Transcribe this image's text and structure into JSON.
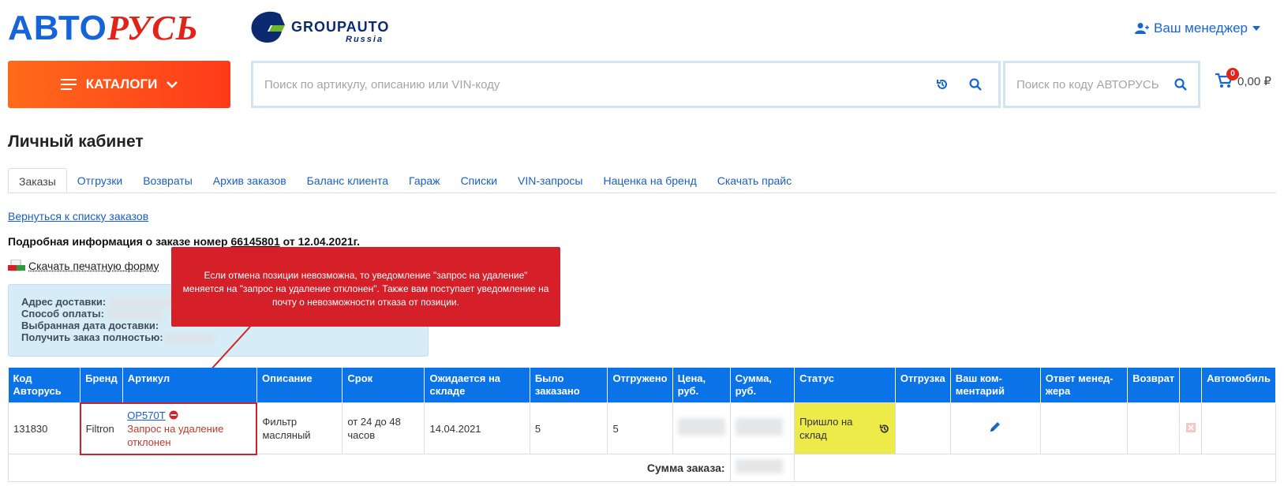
{
  "header": {
    "logo_blue": "АВТО",
    "logo_red": "РУСЬ",
    "partner_name": "GROUPAUTO",
    "partner_sub": "Russia",
    "manager_label": "Ваш менеджер",
    "catalog_label": "КАТАЛОГИ",
    "search_placeholder": "Поиск по артикулу, описанию или VIN-коду",
    "code_search_placeholder": "Поиск по коду АВТОРУСЬ",
    "cart_count": "0",
    "cart_total": "0,00 ₽",
    "colors": {
      "brand_blue": "#1565d8",
      "brand_red": "#e2231a",
      "catalog_orange": "#ff5a1a"
    }
  },
  "page": {
    "title": "Личный кабинет",
    "tabs": [
      {
        "label": "Заказы",
        "active": true
      },
      {
        "label": "Отгрузки"
      },
      {
        "label": "Возвраты"
      },
      {
        "label": "Архив заказов"
      },
      {
        "label": "Баланс клиента"
      },
      {
        "label": "Гараж"
      },
      {
        "label": "Списки"
      },
      {
        "label": "VIN-запросы"
      },
      {
        "label": "Наценка на бренд"
      },
      {
        "label": "Скачать прайс"
      }
    ],
    "back_link": "Вернуться к списку заказов",
    "order_info_prefix": "Подробная информация о заказе номер ",
    "order_number": "66145801",
    "order_info_suffix": " от 12.04.2021г.",
    "print_form": "Скачать печатную форму",
    "delivery": {
      "address_label": "Адрес доставки:",
      "payment_label": "Способ оплаты:",
      "date_label": "Выбранная дата доставки:",
      "full_label": "Получить заказ полностью:"
    },
    "tooltip": "Если отмена позиции невозможна, то уведомление \"запрос на удаление\" меняется на \"запрос на удаление отклонен\". Также вам поступает уведомление на почту о невозможности отказа от позиции."
  },
  "table": {
    "columns": [
      "Код Авторусь",
      "Бренд",
      "Артикул",
      "Описание",
      "Срок",
      "Ожидается на складе",
      "Было заказано",
      "Отгружено",
      "Цена, руб.",
      "Сумма, руб.",
      "Статус",
      "Отгрузка",
      "Ваш ком-ментарий",
      "Ответ менед-жера",
      "Возврат",
      "",
      "Автомобиль"
    ],
    "rows": [
      {
        "code": "131830",
        "brand": "Filtron",
        "article": "OP570T",
        "article_status": "Запрос на удаление отклонен",
        "description": "Фильтр масляный",
        "term": "от 24 до 48 часов",
        "expected": "14.04.2021",
        "ordered": "5",
        "shipped": "5",
        "status": "Пришло на склад"
      }
    ],
    "total_label": "Сумма заказа:"
  }
}
